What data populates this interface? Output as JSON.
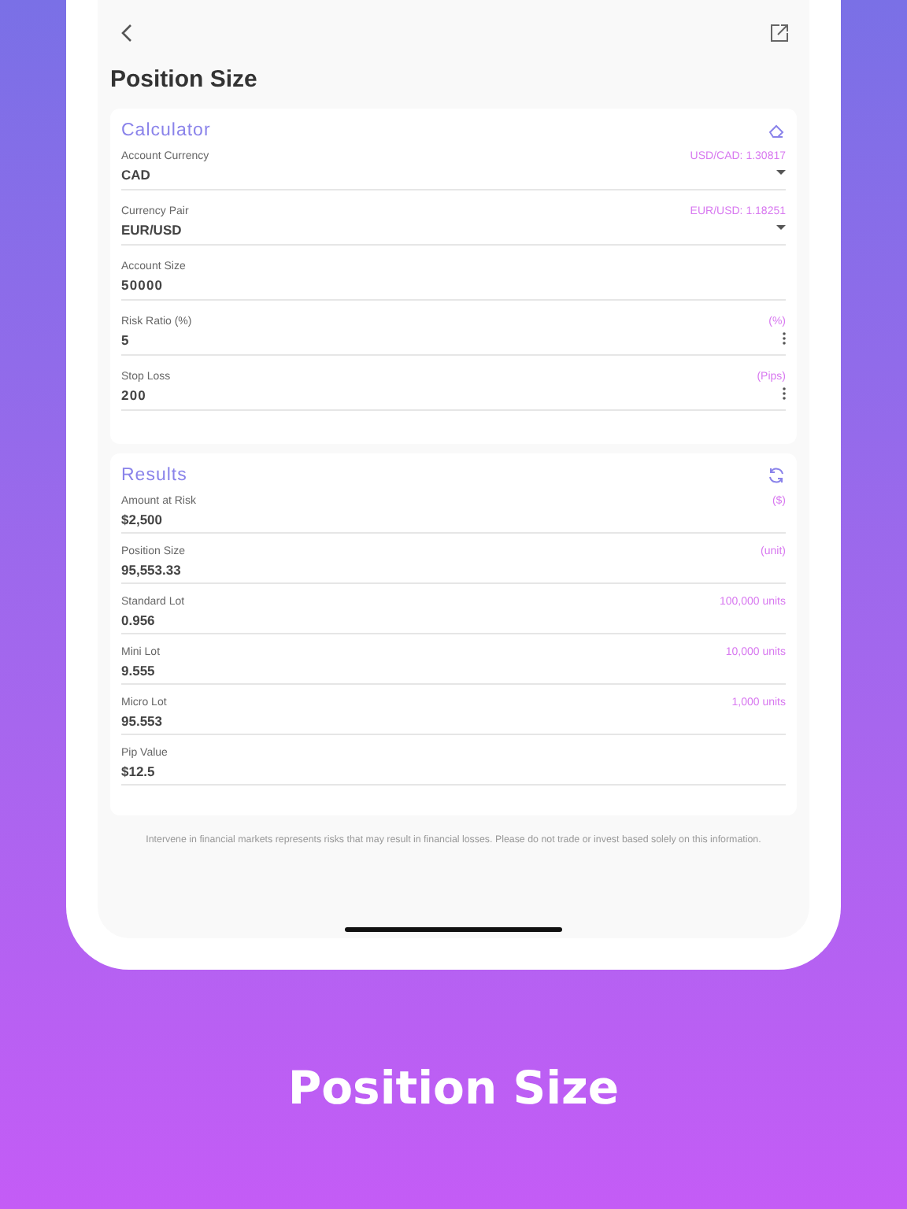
{
  "header": {
    "title": "Position Size"
  },
  "calculator": {
    "title": "Calculator",
    "fields": [
      {
        "kind": "select",
        "label": "Account Currency",
        "value": "CAD",
        "hint": "USD/CAD: 1.30817"
      },
      {
        "kind": "select",
        "label": "Currency Pair",
        "value": "EUR/USD",
        "hint": "EUR/USD: 1.18251"
      },
      {
        "kind": "number",
        "label": "Account Size",
        "value": "50000"
      },
      {
        "kind": "menu",
        "label": "Risk Ratio (%)",
        "value": "5",
        "hint": "(%)"
      },
      {
        "kind": "menu",
        "label": "Stop Loss",
        "value": "200",
        "hint": "(Pips)"
      }
    ]
  },
  "results": {
    "title": "Results",
    "rows": [
      {
        "label": "Amount at Risk",
        "value": "$2,500",
        "hint": "($)"
      },
      {
        "label": "Position Size",
        "value": "95,553.33",
        "hint": "(unit)"
      },
      {
        "label": "Standard Lot",
        "value": "0.956",
        "hint": "100,000 units"
      },
      {
        "label": "Mini Lot",
        "value": "9.555",
        "hint": "10,000 units"
      },
      {
        "label": "Micro Lot",
        "value": "95.553",
        "hint": "1,000 units"
      },
      {
        "label": "Pip Value",
        "value": "$12.5"
      }
    ]
  },
  "disclaimer": "Intervene in financial markets represents risks that may result in financial losses. Please do not trade or invest based solely on this information.",
  "caption": "Position Size"
}
